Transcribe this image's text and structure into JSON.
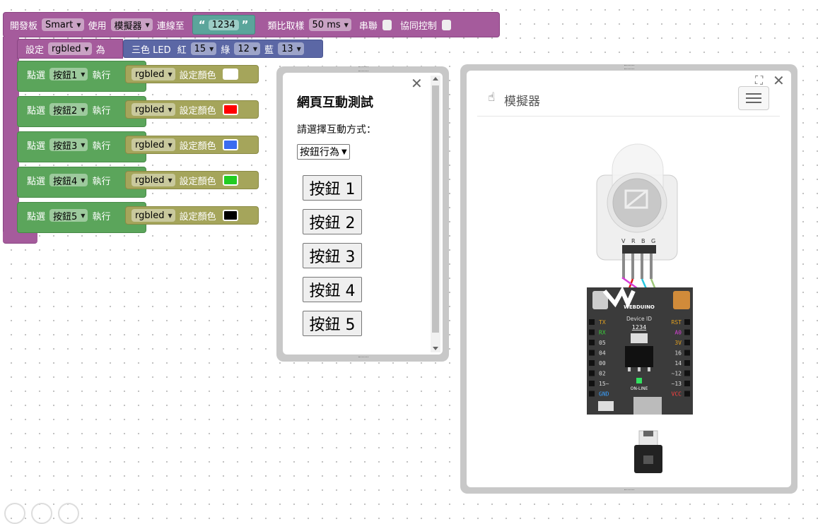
{
  "main_block": {
    "board_label": "開發板",
    "board_value": "Smart",
    "use_label": "使用",
    "mode_value": "模擬器",
    "connect_label": "連線至",
    "device_id": "1234",
    "open_quote": "“",
    "close_quote": "”",
    "sampling_label": "類比取樣",
    "sampling_value": "50 ms",
    "serial_label": "串聯",
    "coop_label": "協同控制"
  },
  "set_block": {
    "set_label": "設定",
    "var_name": "rgbled",
    "as_label": "為",
    "led_label": "三色 LED",
    "red_label": "紅",
    "red_pin": "15",
    "green_label": "綠",
    "green_pin": "12",
    "blue_label": "藍",
    "blue_pin": "13"
  },
  "click_blocks": [
    {
      "click_label": "點選",
      "button": "按鈕1",
      "exec_label": "執行",
      "var": "rgbled",
      "action": "設定顏色",
      "color": "#ffffff"
    },
    {
      "click_label": "點選",
      "button": "按鈕2",
      "exec_label": "執行",
      "var": "rgbled",
      "action": "設定顏色",
      "color": "#ff0000"
    },
    {
      "click_label": "點選",
      "button": "按鈕3",
      "exec_label": "執行",
      "var": "rgbled",
      "action": "設定顏色",
      "color": "#3a6cf0"
    },
    {
      "click_label": "點選",
      "button": "按鈕4",
      "exec_label": "執行",
      "var": "rgbled",
      "action": "設定顏色",
      "color": "#22cc22"
    },
    {
      "click_label": "點選",
      "button": "按鈕5",
      "exec_label": "執行",
      "var": "rgbled",
      "action": "設定顏色",
      "color": "#000000"
    }
  ],
  "interaction_panel": {
    "title": "網頁互動測試",
    "prompt": "請選擇互動方式：",
    "select_value": "按鈕行為",
    "buttons": [
      "按鈕 1",
      "按鈕 2",
      "按鈕 3",
      "按鈕 4",
      "按鈕 5"
    ],
    "close_glyph": "✕"
  },
  "simulator_panel": {
    "title": "模擬器",
    "close_glyph": "✕",
    "expand_glyph": "⛶",
    "led_pin_labels": [
      "V",
      "R",
      "B",
      "G"
    ],
    "board_brand": "WEBDUINO",
    "board_device_label": "Device ID",
    "board_device_id": "1234",
    "online_label": "ON-LINE",
    "left_pins": [
      "TX",
      "RX",
      "05",
      "04",
      "00",
      "02",
      "15~",
      "GND"
    ],
    "right_pins": [
      "RST",
      "A0",
      "3V",
      "16",
      "14",
      "~12",
      "~13",
      "VCC"
    ]
  }
}
